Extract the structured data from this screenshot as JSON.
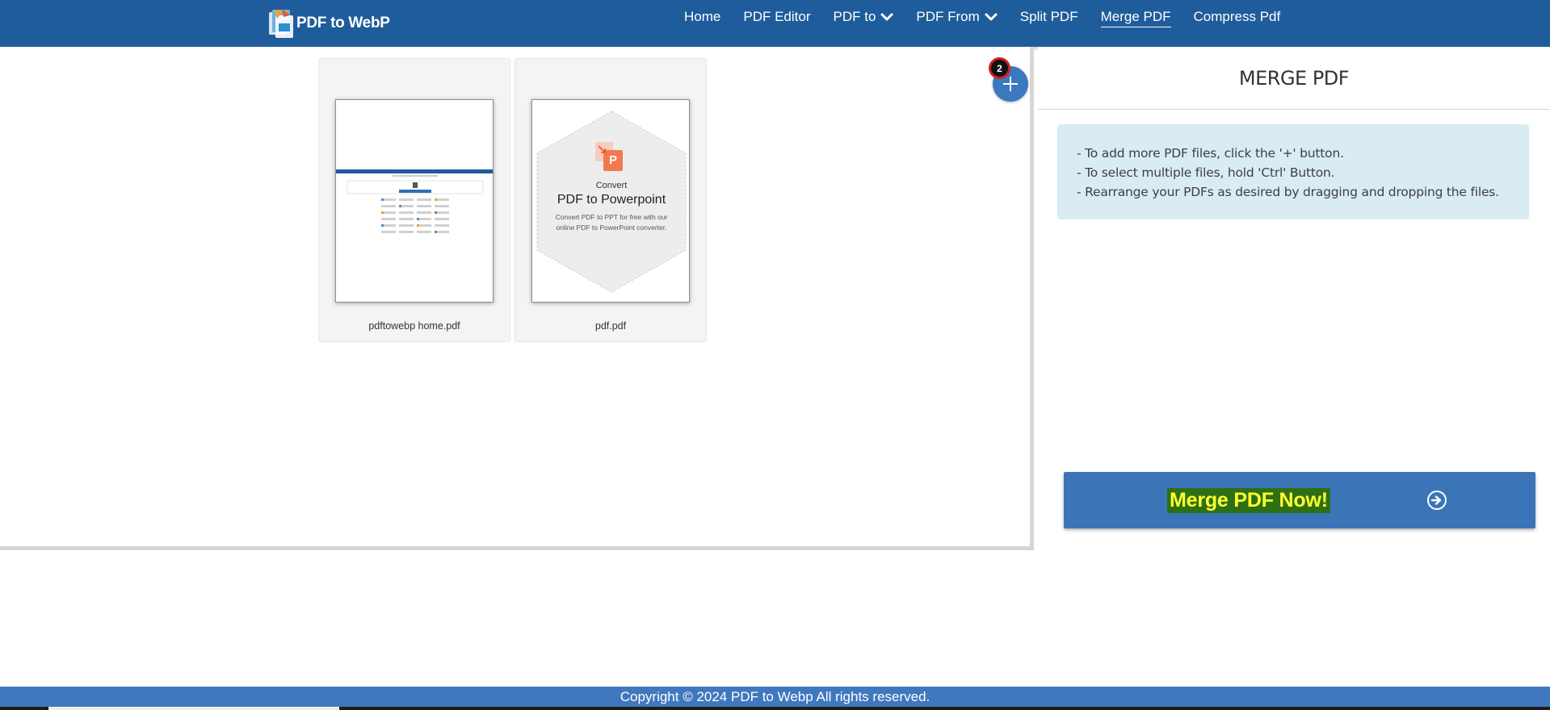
{
  "brand": {
    "name": "PDF to WebP"
  },
  "nav": {
    "items": [
      {
        "label": "Home"
      },
      {
        "label": "PDF Editor"
      },
      {
        "label": "PDF to"
      },
      {
        "label": "PDF From"
      },
      {
        "label": "Split PDF"
      },
      {
        "label": "Merge PDF"
      },
      {
        "label": "Compress Pdf"
      }
    ],
    "active": "Merge PDF"
  },
  "files": [
    {
      "name": "pdftowebp home.pdf"
    },
    {
      "name": "pdf.pdf",
      "thumb": {
        "heading_small": "Convert",
        "heading_large": "PDF to Powerpoint",
        "body_line1": "Convert PDF to PPT for free with our",
        "body_line2": "online PDF to PowerPoint converter.",
        "icon_letter": "P"
      }
    }
  ],
  "add_button": {
    "badge_count": "2"
  },
  "panel": {
    "title": "MERGE PDF",
    "instructions": [
      "- To add more PDF files, click the '+' button.",
      "- To select multiple files, hold 'Ctrl' Button.",
      "- Rearrange your PDFs as desired by dragging and dropping the files."
    ],
    "merge_button_label": "Merge PDF Now!"
  },
  "footer": {
    "copyright": "Copyright © 2024 PDF to Webp All rights reserved."
  },
  "colors": {
    "header_bg": "#1f5c9c",
    "footer_bg": "#3f78bf",
    "accent_button": "#3b75b8",
    "info_bg": "#d9ecf4",
    "badge_ring": "#d41f1f",
    "merge_label_text": "#ffff2e",
    "merge_label_bg": "#2e6f14",
    "ppt_orange": "#f07a4e"
  }
}
